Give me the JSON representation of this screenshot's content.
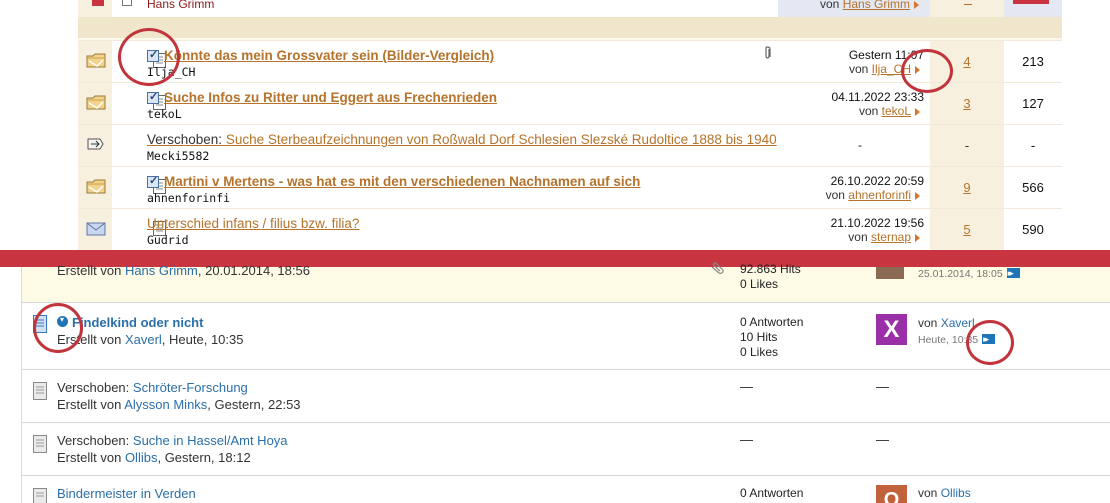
{
  "old_forum": {
    "partial_row": {
      "author": "Hans Grimm",
      "last_post_by_prefix": "von",
      "last_post_by": "Hans Grimm"
    },
    "threads": [
      {
        "title": "Könnte das mein Grossvater sein (Bilder-Vergleich)",
        "bold": true,
        "checked": true,
        "attachment": true,
        "author": "Ilja_CH",
        "last_date": "Gestern 11:07",
        "last_by": "Ilja_CH",
        "replies": "4",
        "hits": "213",
        "icon": "folder-hot-icon"
      },
      {
        "title": "Suche Infos zu Ritter und Eggert aus Frechenrieden",
        "bold": true,
        "checked": true,
        "author": "tekoL",
        "last_date": "04.11.2022 23:33",
        "last_by": "tekoL",
        "replies": "3",
        "hits": "127",
        "icon": "folder-hot-icon"
      },
      {
        "prefix": "Verschoben:",
        "title": "Suche Sterbeaufzeichnungen von Roßwald Dorf Schlesien Slezské Rudoltice 1888 bis 1940",
        "bold": false,
        "checked": false,
        "author": "Mecki5582",
        "last_date": "-",
        "replies": "-",
        "hits": "-",
        "icon": "moved-icon"
      },
      {
        "title": "Martini v Mertens - was hat es mit den verschiedenen Nachnamen auf sich",
        "bold": true,
        "checked": true,
        "author": "ahnenforinfi",
        "last_date": "26.10.2022 20:59",
        "last_by": "ahnenforinfi",
        "replies": "9",
        "hits": "566",
        "icon": "folder-hot-icon"
      },
      {
        "title": "Unterschied infans / filius bzw. filia?",
        "bold": false,
        "checked": false,
        "author": "Gudrid",
        "last_date": "21.10.2022 19:56",
        "last_by": "sternap",
        "replies": "5",
        "hits": "590",
        "icon": "envelope-icon"
      }
    ],
    "von": "von"
  },
  "new_forum": {
    "sticky": {
      "created_prefix": "Erstellt von",
      "author": "Hans Grimm",
      "created_date": "20.01.2014, 18:56",
      "hits": "92.863 Hits",
      "likes": "0 Likes",
      "last_date": "25.01.2014, 18:05"
    },
    "threads": [
      {
        "title": "Findelkind oder nicht",
        "bold": true,
        "unread": true,
        "created_prefix": "Erstellt von",
        "author": "Xaverl",
        "created_date": "Heute, 10:35",
        "replies": "0 Antworten",
        "hits": "10 Hits",
        "likes": "0 Likes",
        "last_by_prefix": "von",
        "last_by": "Xaverl",
        "last_date": "Heute, 10:35",
        "avatar_letter": "X",
        "avatar_color": "#9b2fa8"
      },
      {
        "prefix": "Verschoben:",
        "title": "Schröter-Forschung",
        "created_prefix": "Erstellt von",
        "author": "Alysson Minks",
        "created_date": "Gestern, 22:53",
        "stats_dash": "—",
        "last_dash": "—"
      },
      {
        "prefix": "Verschoben:",
        "title": "Suche in Hassel/Amt Hoya",
        "created_prefix": "Erstellt von",
        "author": "Ollibs",
        "created_date": "Gestern, 18:12",
        "stats_dash": "—",
        "last_dash": "—"
      },
      {
        "title": "Bindermeister in Verden",
        "replies": "0 Antworten",
        "last_by_prefix": "von",
        "last_by": "Ollibs",
        "avatar_letter": "O",
        "avatar_color": "#c0633c"
      }
    ]
  },
  "colors": {
    "annotation_red": "#c1343c",
    "separator_red": "#c8343f",
    "old_link": "#b5732b",
    "new_link": "#2b6fa8"
  }
}
